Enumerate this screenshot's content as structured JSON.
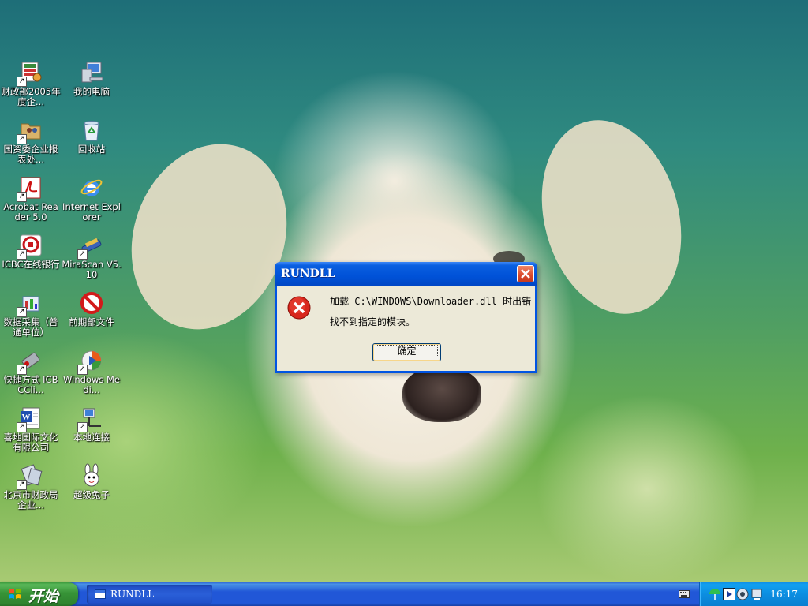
{
  "desktop": {
    "icons": [
      {
        "label": "财政部2005年度企...",
        "icon": "spreadsheet-icon",
        "shortcut": true
      },
      {
        "label": "我的电脑",
        "icon": "computer-icon",
        "shortcut": false
      },
      {
        "label": "国资委企业报表处...",
        "icon": "folder-people-icon",
        "shortcut": true
      },
      {
        "label": "回收站",
        "icon": "recycle-bin-icon",
        "shortcut": false
      },
      {
        "label": "Acrobat Reader 5.0",
        "icon": "acrobat-icon",
        "shortcut": true
      },
      {
        "label": "Internet Explorer",
        "icon": "ie-icon",
        "shortcut": false
      },
      {
        "label": "ICBC在线银行",
        "icon": "icbc-icon",
        "shortcut": true
      },
      {
        "label": "MiraScan V5.10",
        "icon": "scanner-icon",
        "shortcut": true
      },
      {
        "label": "数据采集（普通单位）",
        "icon": "data-collect-icon",
        "shortcut": true
      },
      {
        "label": "前期部文件",
        "icon": "forbidden-folder-icon",
        "shortcut": false
      },
      {
        "label": "快捷方式 ICBCCli...",
        "icon": "usb-key-icon",
        "shortcut": true
      },
      {
        "label": "Windows Medi...",
        "icon": "media-player-icon",
        "shortcut": true
      },
      {
        "label": "喜地国际文化有限公司",
        "icon": "word-doc-icon",
        "shortcut": true
      },
      {
        "label": "本地连接",
        "icon": "network-icon",
        "shortcut": true
      },
      {
        "label": "北京市财政局企业...",
        "icon": "finance-app-icon",
        "shortcut": true
      },
      {
        "label": "超级兔子",
        "icon": "rabbit-icon",
        "shortcut": false
      }
    ]
  },
  "dialog": {
    "title": "RUNDLL",
    "message_line1": "加载 C:\\WINDOWS\\Downloader.dll 时出错",
    "message_line2": "找不到指定的模块。",
    "ok_label": "确定",
    "icon": "error-icon"
  },
  "taskbar": {
    "start_label": "开始",
    "tasks": [
      {
        "label": "RUNDLL"
      }
    ],
    "clock": "16:17"
  },
  "colors": {
    "titlebar": "#0054e3",
    "taskbar": "#2157d7",
    "start_button": "#379337",
    "tray": "#0c8ee1",
    "dialog_body": "#ece9d8",
    "error_red": "#d8261c"
  }
}
